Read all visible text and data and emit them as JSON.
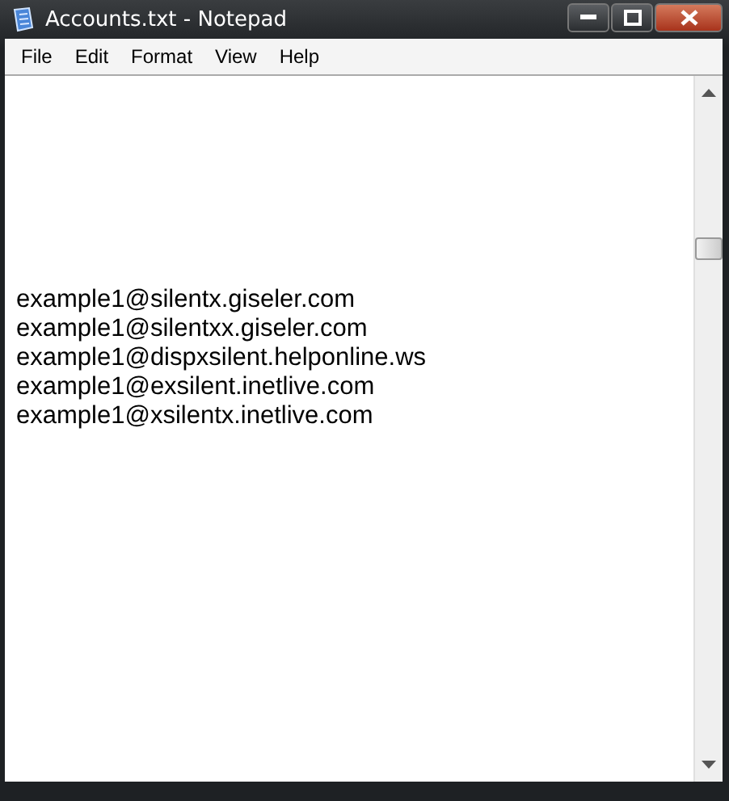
{
  "window": {
    "title": "Accounts.txt - Notepad"
  },
  "menu": [
    "File",
    "Edit",
    "Format",
    "View",
    "Help"
  ],
  "document": {
    "lines": [
      "example1@silentx.giseler.com",
      "example1@silentxx.giseler.com",
      "example1@dispxsilent.helponline.ws",
      "example1@exsilent.inetlive.com",
      "example1@xsilentx.inetlive.com"
    ]
  }
}
